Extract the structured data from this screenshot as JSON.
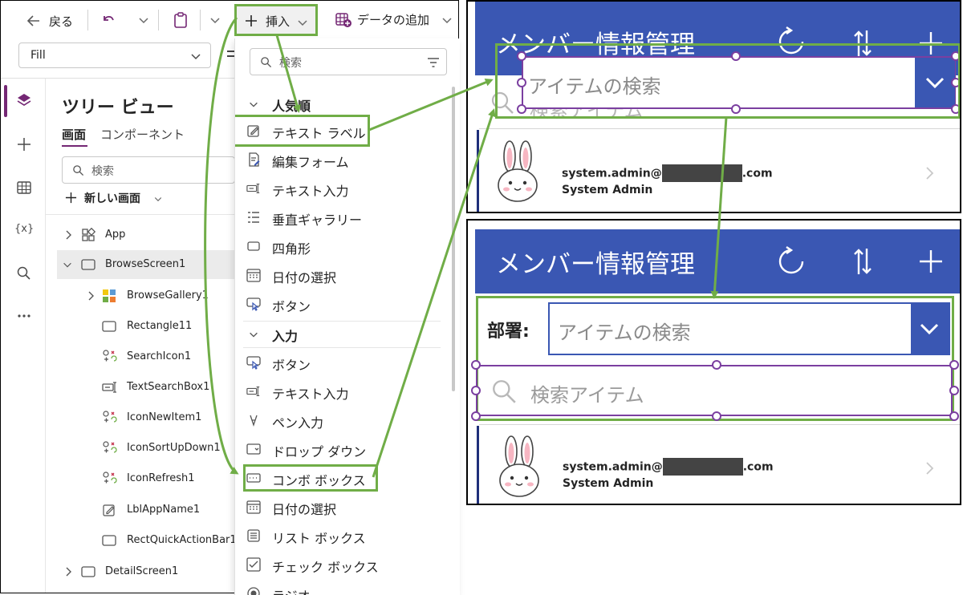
{
  "studio": {
    "toolbar": {
      "back_label": "戻る",
      "insert_label": "挿入",
      "add_data_label": "データの追加"
    },
    "property_value": "Fill",
    "tree": {
      "title": "ツリー ビュー",
      "tabs": [
        "画面",
        "コンポーネント"
      ],
      "search_placeholder": "検索",
      "new_screen_label": "新しい画面",
      "items": [
        {
          "label": "App",
          "icon": "app-icon"
        },
        {
          "label": "BrowseScreen1",
          "icon": "screen-icon"
        },
        {
          "label": "BrowseGallery1",
          "icon": "gallery-icon"
        },
        {
          "label": "Rectangle11",
          "icon": "rectangle-icon"
        },
        {
          "label": "SearchIcon1",
          "icon": "icon-control-icon"
        },
        {
          "label": "TextSearchBox1",
          "icon": "text-input-icon"
        },
        {
          "label": "IconNewItem1",
          "icon": "icon-control-icon"
        },
        {
          "label": "IconSortUpDown1",
          "icon": "icon-control-icon"
        },
        {
          "label": "IconRefresh1",
          "icon": "icon-control-icon"
        },
        {
          "label": "LblAppName1",
          "icon": "label-edit-icon"
        },
        {
          "label": "RectQuickActionBar1",
          "icon": "rectangle-icon"
        },
        {
          "label": "DetailScreen1",
          "icon": "screen-icon"
        }
      ]
    },
    "rail_icons": [
      "layers-icon",
      "plus-icon",
      "table-icon",
      "variables-icon",
      "search-icon",
      "more-icon"
    ],
    "rail_variables_text": "{x}"
  },
  "insert_menu": {
    "search_placeholder": "検索",
    "sections": [
      {
        "title": "人気順",
        "items": [
          "テキスト ラベル",
          "編集フォーム",
          "テキスト入力",
          "垂直ギャラリー",
          "四角形",
          "日付の選択",
          "ボタン"
        ]
      },
      {
        "title": "入力",
        "items": [
          "ボタン",
          "テキスト入力",
          "ペン入力",
          "ドロップ ダウン",
          "コンボ ボックス",
          "日付の選択",
          "リスト ボックス",
          "チェック ボックス",
          "ラジオ"
        ]
      }
    ]
  },
  "preview_top": {
    "header_title": "メンバー情報管理",
    "combo_placeholder": "アイテムの検索",
    "search_placeholder_partial": "検索アイテム",
    "user_email_prefix": "system.admin@",
    "user_email_suffix": ".com",
    "user_name": "System Admin"
  },
  "preview_bottom": {
    "header_title": "メンバー情報管理",
    "dept_label": "部署:",
    "combo_placeholder": "アイテムの検索",
    "search_placeholder": "検索アイテム",
    "user_email_prefix": "system.admin@",
    "user_email_suffix": ".com",
    "user_name": "System Admin"
  },
  "colors": {
    "header_blue": "#3a57b3",
    "highlight_green": "#70ad47",
    "selection_purple": "#7b3fa0",
    "accent_purple": "#742774"
  }
}
